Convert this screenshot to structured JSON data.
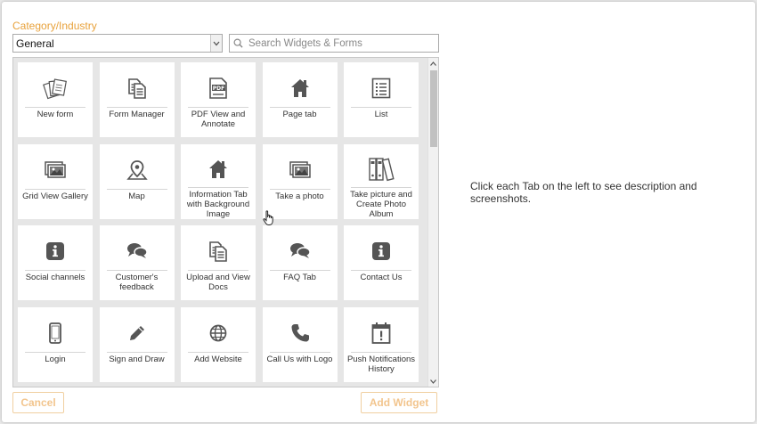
{
  "filter": {
    "category_label": "Category/Industry",
    "category_value": "General",
    "search_placeholder": "Search Widgets & Forms"
  },
  "widgets": [
    {
      "label": "New form",
      "icon": "forms-stack-icon"
    },
    {
      "label": "Form Manager",
      "icon": "documents-icon"
    },
    {
      "label": "PDF View and Annotate",
      "icon": "pdf-icon"
    },
    {
      "label": "Page tab",
      "icon": "home-icon"
    },
    {
      "label": "List",
      "icon": "list-icon"
    },
    {
      "label": "Grid View Gallery",
      "icon": "photos-icon"
    },
    {
      "label": "Map",
      "icon": "map-pin-icon"
    },
    {
      "label": "Information Tab with Background Image",
      "icon": "home-icon"
    },
    {
      "label": "Take a photo",
      "icon": "photos-icon"
    },
    {
      "label": "Take picture and Create Photo Album",
      "icon": "binders-icon"
    },
    {
      "label": "Social channels",
      "icon": "info-icon"
    },
    {
      "label": "Customer's feedback",
      "icon": "chat-bubbles-icon"
    },
    {
      "label": "Upload and View Docs",
      "icon": "documents-icon"
    },
    {
      "label": "FAQ Tab",
      "icon": "chat-bubbles-icon"
    },
    {
      "label": "Contact Us",
      "icon": "info-icon"
    },
    {
      "label": "Login",
      "icon": "mobile-icon"
    },
    {
      "label": "Sign and Draw",
      "icon": "pencil-icon"
    },
    {
      "label": "Add Website",
      "icon": "globe-icon"
    },
    {
      "label": "Call Us with Logo",
      "icon": "phone-icon"
    },
    {
      "label": "Push Notifications History",
      "icon": "calendar-alert-icon"
    }
  ],
  "buttons": {
    "cancel": "Cancel",
    "add_widget": "Add Widget"
  },
  "description": "Click each Tab on the left to see description and screenshots.",
  "colors": {
    "accent": "#e8a23c",
    "icon": "#555555"
  }
}
